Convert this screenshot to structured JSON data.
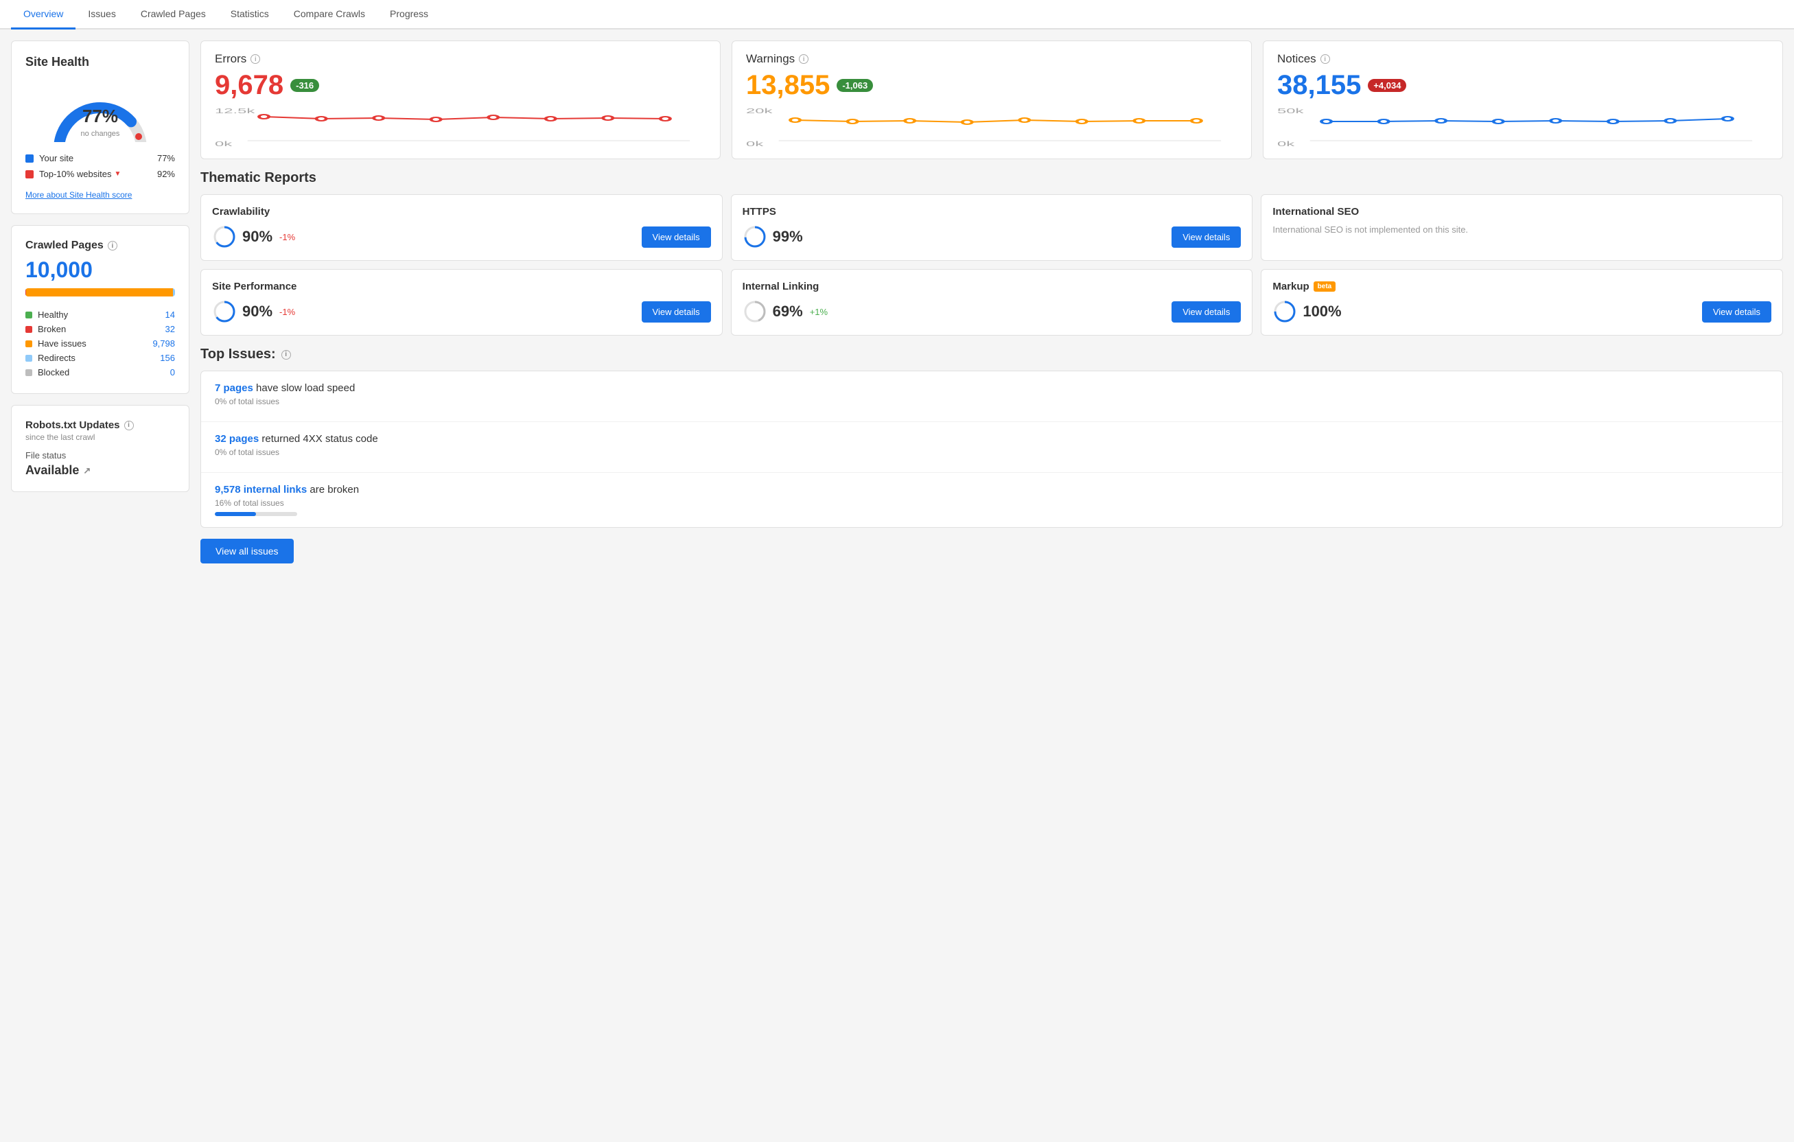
{
  "tabs": {
    "items": [
      {
        "label": "Overview",
        "active": true
      },
      {
        "label": "Issues",
        "active": false
      },
      {
        "label": "Crawled Pages",
        "active": false
      },
      {
        "label": "Statistics",
        "active": false
      },
      {
        "label": "Compare Crawls",
        "active": false
      },
      {
        "label": "Progress",
        "active": false
      }
    ]
  },
  "site_health": {
    "title": "Site Health",
    "percent": "77%",
    "sub_label": "no changes",
    "legend": [
      {
        "label": "Your site",
        "value": "77%",
        "color": "#1a73e8"
      },
      {
        "label": "Top-10% websites",
        "value": "92%",
        "color": "#e53935",
        "arrow": true
      }
    ],
    "more_link": "More about Site Health score"
  },
  "crawled_pages": {
    "title": "Crawled Pages",
    "number": "10,000",
    "stats": [
      {
        "label": "Healthy",
        "value": "14",
        "color_class": "dot-green"
      },
      {
        "label": "Broken",
        "value": "32",
        "color_class": "dot-red"
      },
      {
        "label": "Have issues",
        "value": "9,798",
        "color_class": "dot-orange"
      },
      {
        "label": "Redirects",
        "value": "156",
        "color_class": "dot-blue"
      },
      {
        "label": "Blocked",
        "value": "0",
        "color_class": "dot-gray"
      }
    ]
  },
  "robots": {
    "title": "Robots.txt Updates",
    "subtitle": "since the last crawl",
    "file_status_label": "File status",
    "file_status_value": "Available"
  },
  "errors": {
    "title": "Errors",
    "value": "9,678",
    "badge": "-316",
    "badge_type": "green",
    "y_top": "12.5k",
    "y_bot": "0k"
  },
  "warnings": {
    "title": "Warnings",
    "value": "13,855",
    "badge": "-1,063",
    "badge_type": "green",
    "y_top": "20k",
    "y_bot": "0k"
  },
  "notices": {
    "title": "Notices",
    "value": "38,155",
    "badge": "+4,034",
    "badge_type": "red",
    "y_top": "50k",
    "y_bot": "0k"
  },
  "thematic_reports": {
    "section_title": "Thematic Reports",
    "items": [
      {
        "title": "Crawlability",
        "score": "90%",
        "change": "-1%",
        "change_type": "neg",
        "has_button": true
      },
      {
        "title": "HTTPS",
        "score": "99%",
        "change": "",
        "change_type": "",
        "has_button": true
      },
      {
        "title": "International SEO",
        "score": "",
        "change": "",
        "change_type": "",
        "has_button": false,
        "note": "International SEO is not implemented on this site."
      },
      {
        "title": "Site Performance",
        "score": "90%",
        "change": "-1%",
        "change_type": "neg",
        "has_button": true
      },
      {
        "title": "Internal Linking",
        "score": "69%",
        "change": "+1%",
        "change_type": "pos",
        "has_button": true
      },
      {
        "title": "Markup",
        "score": "100%",
        "change": "",
        "change_type": "",
        "has_button": true,
        "beta": true
      }
    ],
    "view_details_label": "View details"
  },
  "top_issues": {
    "section_title": "Top Issues:",
    "issues": [
      {
        "link_text": "7 pages",
        "rest_text": " have slow load speed",
        "sub_text": "0% of total issues",
        "bar_width": "0%"
      },
      {
        "link_text": "32 pages",
        "rest_text": " returned 4XX status code",
        "sub_text": "0% of total issues",
        "bar_width": "0%"
      },
      {
        "link_text": "9,578 internal links",
        "rest_text": " are broken",
        "sub_text": "16% of total issues",
        "bar_width": "16%"
      }
    ],
    "view_all_label": "View all issues"
  }
}
